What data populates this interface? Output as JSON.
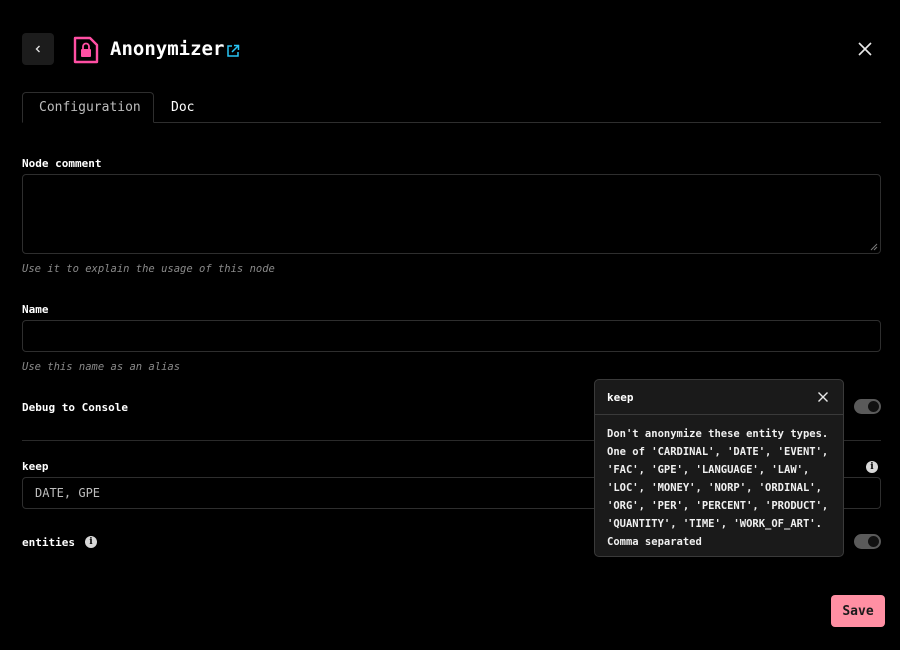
{
  "header": {
    "title": "Anonymizer",
    "icons": {
      "back": "chevron-left-icon",
      "node": "lock-document-icon",
      "external": "external-link-icon",
      "close": "close-icon"
    },
    "accent_node_color": "#ff4fa3",
    "link_color": "#29c5f6"
  },
  "tabs": [
    {
      "label": "Configuration",
      "active": true
    },
    {
      "label": "Doc",
      "active": false
    }
  ],
  "form": {
    "node_comment": {
      "label": "Node comment",
      "value": "",
      "hint": "Use it to explain the usage of this node"
    },
    "name": {
      "label": "Name",
      "value": "",
      "hint": "Use this name as an alias"
    },
    "debug": {
      "label": "Debug to Console",
      "enabled": true
    },
    "keep": {
      "label": "keep",
      "value": "DATE, GPE"
    },
    "entities": {
      "label": "entities",
      "enabled": true
    }
  },
  "tooltip": {
    "title": "keep",
    "lines": [
      "Don't anonymize these entity types.",
      "One of 'CARDINAL', 'DATE', 'EVENT',",
      "'FAC', 'GPE', 'LANGUAGE', 'LAW',",
      "'LOC', 'MONEY', 'NORP', 'ORDINAL',",
      "'ORG', 'PER', 'PERCENT', 'PRODUCT',",
      "'QUANTITY', 'TIME', 'WORK_OF_ART'.",
      "Comma separated"
    ]
  },
  "footer": {
    "save_label": "Save",
    "save_color": "#ff8fa3"
  }
}
